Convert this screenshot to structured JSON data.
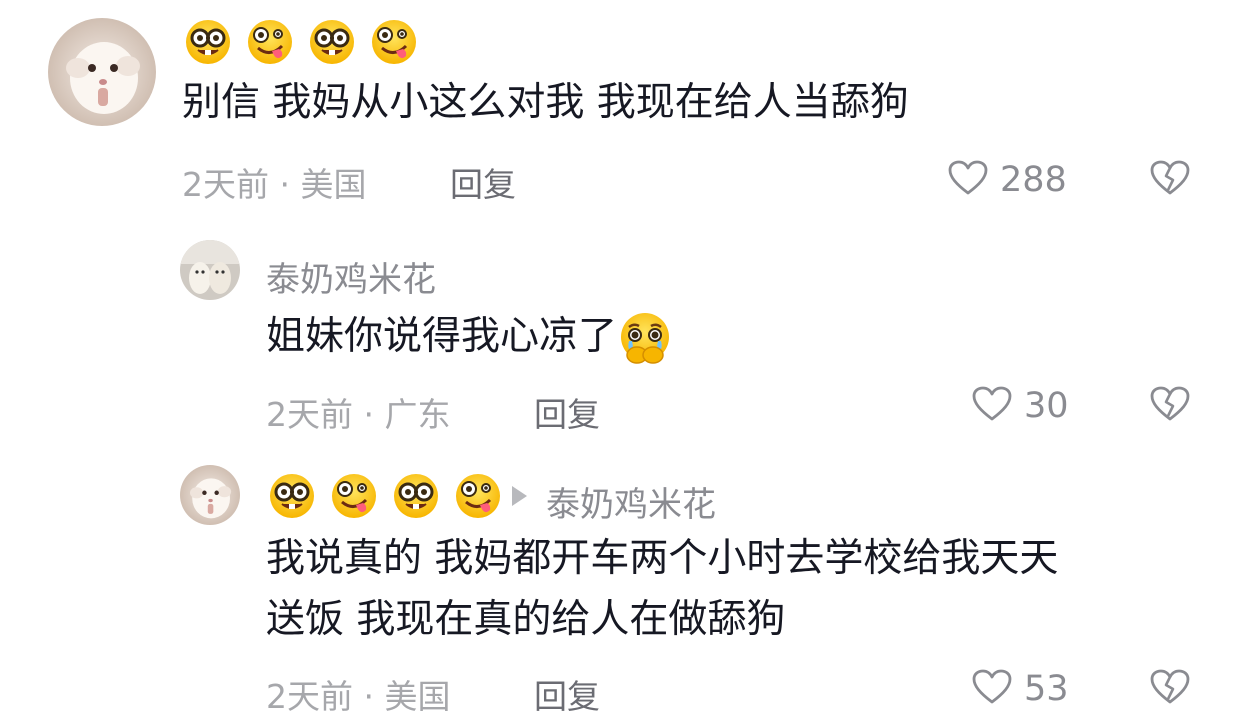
{
  "comments": [
    {
      "author_emoji": [
        "nerd-face",
        "zany-face",
        "nerd-face",
        "zany-face"
      ],
      "text": "别信 我妈从小这么对我 我现在给人当舔狗",
      "meta": "2天前 · 美国",
      "reply_label": "回复",
      "likes": "288"
    },
    {
      "author_name": "泰奶鸡米花",
      "text": "姐妹你说得我心凉了",
      "text_emoji": "face-holding-back-tears",
      "meta": "2天前 · 广东",
      "reply_label": "回复",
      "likes": "30"
    },
    {
      "author_emoji": [
        "nerd-face",
        "zany-face",
        "nerd-face",
        "zany-face"
      ],
      "reply_to": "泰奶鸡米花",
      "text_line1": "我说真的 我妈都开车两个小时去学校给我天天",
      "text_line2": "送饭 我现在真的给人在做舔狗",
      "meta": "2天前 · 美国",
      "reply_label": "回复",
      "likes": "53"
    }
  ]
}
